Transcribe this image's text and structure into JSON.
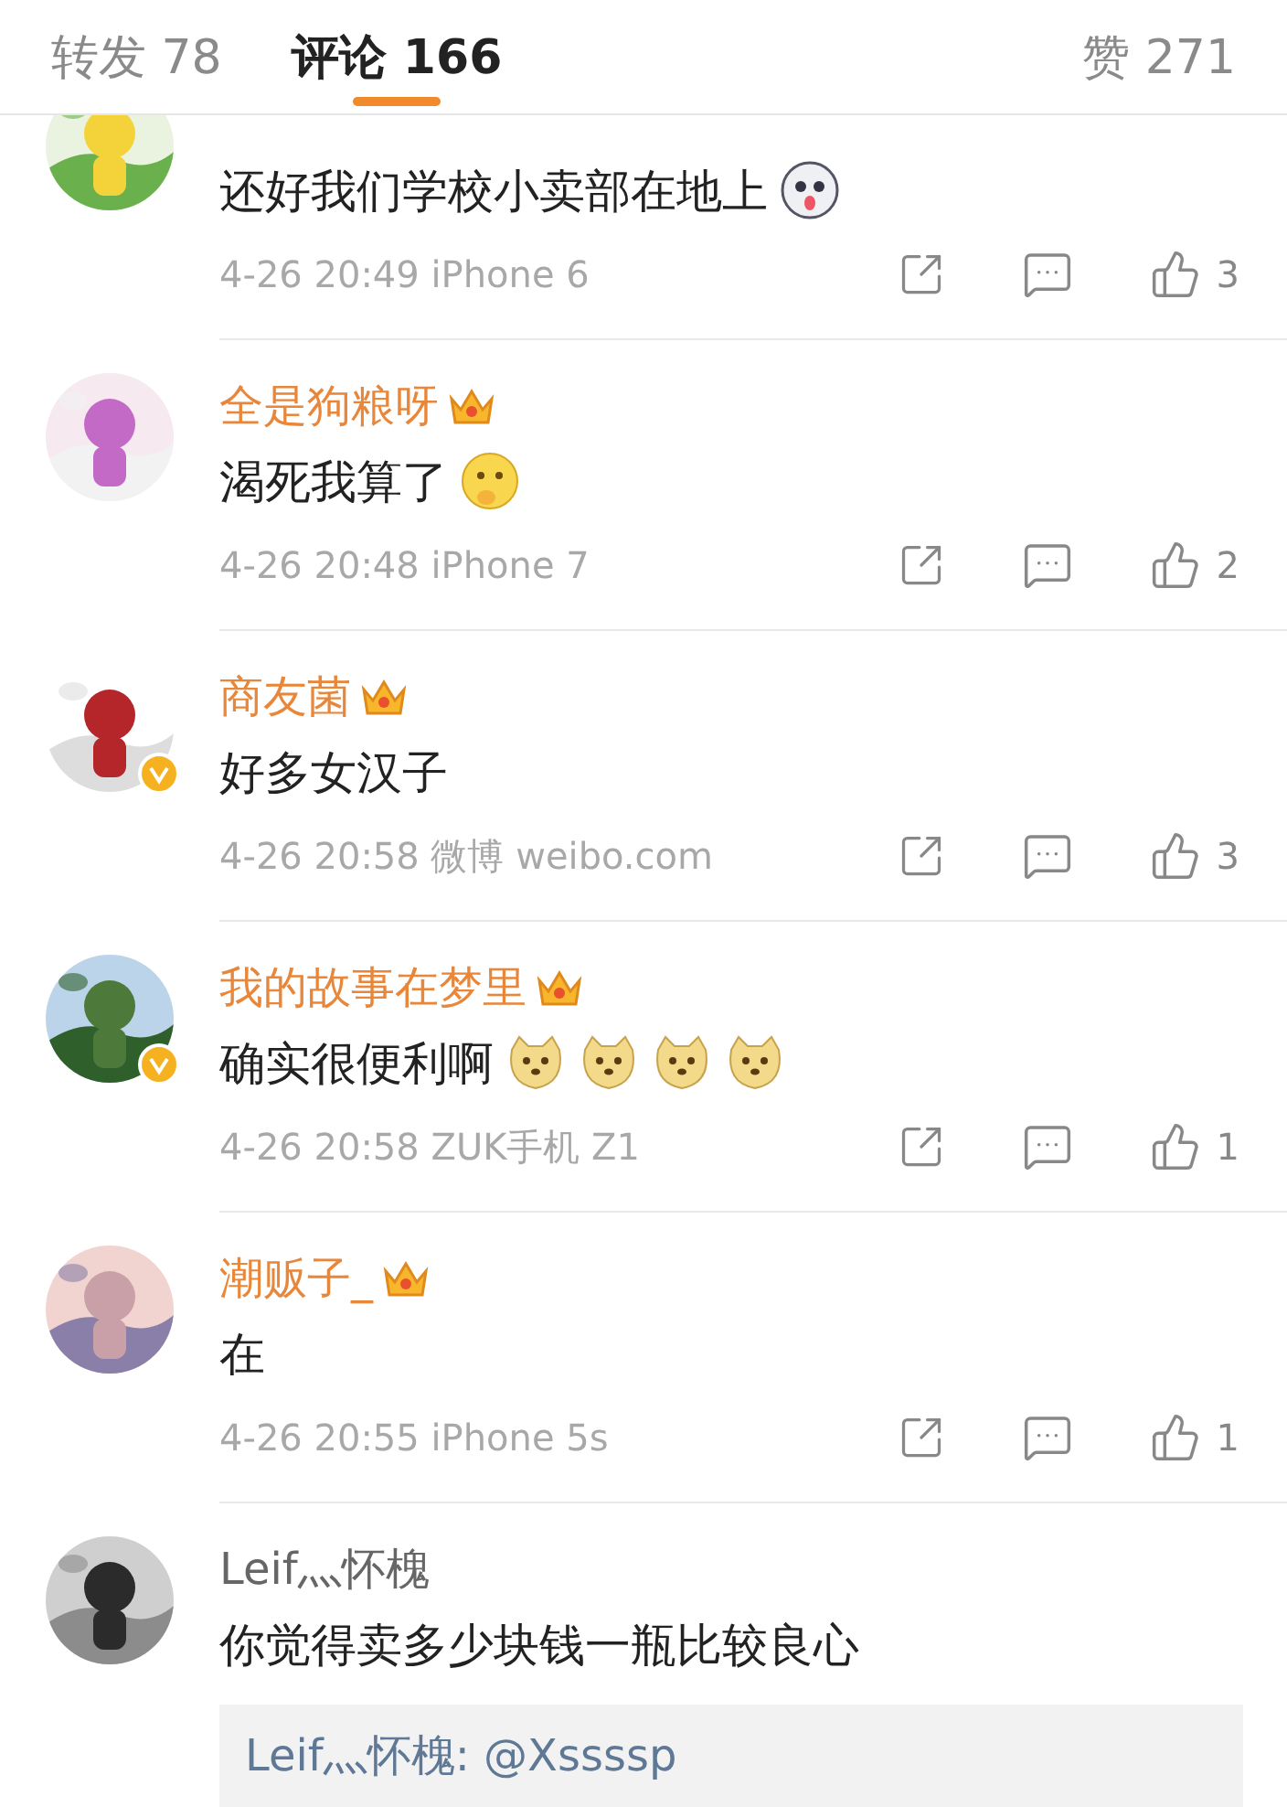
{
  "tabs": [
    {
      "label": "转发 78",
      "selected": false
    },
    {
      "label": "评论 166",
      "selected": true
    },
    {
      "label": "赞 271",
      "selected": false
    }
  ],
  "comments": [
    {
      "verified": false,
      "content": "还好我们学校小卖部在地上",
      "emojis": [
        {
          "kind": "husky"
        }
      ],
      "meta": "4-26 20:49 iPhone 6",
      "likes": "3"
    },
    {
      "name": "全是狗粮呀",
      "vip": true,
      "verified": false,
      "content": "渴死我算了",
      "emojis": [
        {
          "kind": "thinking"
        }
      ],
      "meta": "4-26 20:48 iPhone 7",
      "likes": "2"
    },
    {
      "name": "商友菌",
      "vip": true,
      "verified": true,
      "content": "好多女汉子",
      "meta": "4-26 20:58 微博 weibo.com",
      "likes": "3"
    },
    {
      "name": "我的故事在梦里",
      "vip": true,
      "verified": true,
      "content": "确实很便利啊",
      "emojis": [
        {
          "kind": "doge"
        },
        {
          "kind": "doge"
        },
        {
          "kind": "doge"
        },
        {
          "kind": "doge"
        }
      ],
      "meta": "4-26 20:58 ZUK手机 Z1",
      "likes": "1"
    },
    {
      "name": "潮贩子_",
      "vip": true,
      "verified": false,
      "content": "在",
      "meta": "4-26 20:55 iPhone 5s",
      "likes": "1"
    },
    {
      "name": "Leif灬怀槐",
      "vip": false,
      "verified": false,
      "content": "你觉得卖多少块钱一瓶比较良心",
      "reply": "Leif灬怀槐: @Xssssp"
    }
  ]
}
